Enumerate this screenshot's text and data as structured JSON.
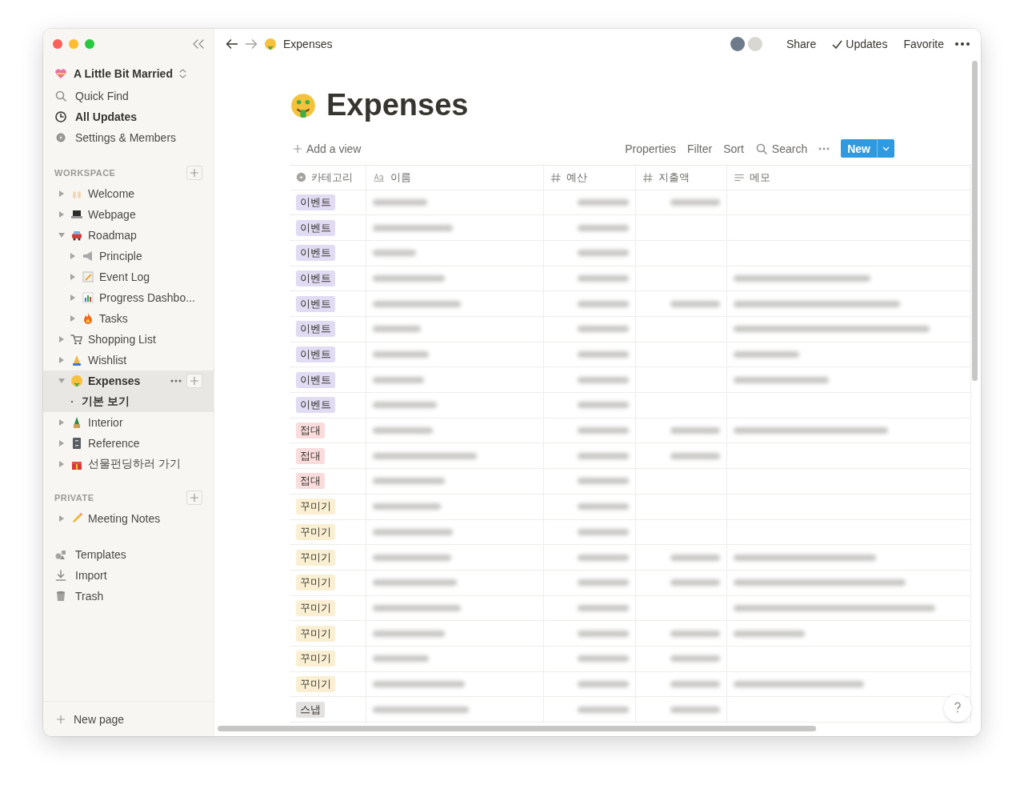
{
  "sidebar": {
    "workspace": "A Little Bit Married",
    "nav": [
      {
        "kind": "search",
        "label": "Quick Find",
        "selected": false
      },
      {
        "kind": "clock",
        "label": "All Updates",
        "selected": true
      },
      {
        "kind": "gear",
        "label": "Settings & Members",
        "selected": false
      }
    ],
    "sections": [
      {
        "title": "WORKSPACE",
        "pages": [
          {
            "label": "Welcome",
            "expanded": false,
            "selected": false
          },
          {
            "label": "Webpage",
            "expanded": false,
            "selected": false
          },
          {
            "label": "Roadmap",
            "expanded": true,
            "selected": false,
            "children": [
              {
                "label": "Principle",
                "expanded": false,
                "selected": false
              },
              {
                "label": "Event Log",
                "expanded": false,
                "selected": false
              },
              {
                "label": "Progress Dashbo...",
                "expanded": false,
                "selected": false
              },
              {
                "label": "Tasks",
                "expanded": false,
                "selected": false
              }
            ]
          },
          {
            "label": "Shopping List",
            "expanded": false,
            "selected": false
          },
          {
            "label": "Wishlist",
            "expanded": false,
            "selected": false
          },
          {
            "label": "Expenses",
            "expanded": true,
            "selected": true,
            "views": [
              {
                "label": "기본 보기",
                "selected": true
              }
            ]
          },
          {
            "label": "Interior",
            "expanded": false,
            "selected": false
          },
          {
            "label": "Reference",
            "expanded": false,
            "selected": false
          },
          {
            "label": "선물펀딩하러 가기",
            "expanded": false,
            "selected": false
          }
        ]
      },
      {
        "title": "PRIVATE",
        "pages": [
          {
            "label": "Meeting Notes",
            "expanded": false,
            "selected": false
          }
        ]
      }
    ],
    "tools": [
      {
        "kind": "templates",
        "label": "Templates"
      },
      {
        "kind": "import",
        "label": "Import"
      },
      {
        "kind": "trash",
        "label": "Trash"
      }
    ],
    "new_page": "New page"
  },
  "topbar": {
    "breadcrumb": "Expenses",
    "actions": [
      {
        "kind": "text",
        "label": "Share"
      },
      {
        "kind": "check",
        "label": "Updates"
      },
      {
        "kind": "text",
        "label": "Favorite"
      }
    ]
  },
  "page": {
    "title": "Expenses",
    "toolbar": {
      "add_view": "Add a view",
      "options": [
        "Properties",
        "Filter",
        "Sort"
      ],
      "search": "Search",
      "new": "New"
    },
    "table": {
      "columns": [
        {
          "kind": "select",
          "label": "카테고리"
        },
        {
          "kind": "title",
          "label": "이름"
        },
        {
          "kind": "number",
          "label": "예산"
        },
        {
          "kind": "number",
          "label": "지출액"
        },
        {
          "kind": "text",
          "label": "메모"
        }
      ],
      "rows": [
        {
          "category": "이벤트",
          "color": "#e2dbf4",
          "spent": true,
          "memo": false
        },
        {
          "category": "이벤트",
          "color": "#e2dbf4",
          "spent": false,
          "memo": false
        },
        {
          "category": "이벤트",
          "color": "#e2dbf4",
          "spent": false,
          "memo": false
        },
        {
          "category": "이벤트",
          "color": "#e2dbf4",
          "spent": false,
          "memo": true
        },
        {
          "category": "이벤트",
          "color": "#e2dbf4",
          "spent": true,
          "memo": true
        },
        {
          "category": "이벤트",
          "color": "#e2dbf4",
          "spent": false,
          "memo": true
        },
        {
          "category": "이벤트",
          "color": "#e2dbf4",
          "spent": false,
          "memo": true
        },
        {
          "category": "이벤트",
          "color": "#e2dbf4",
          "spent": false,
          "memo": true
        },
        {
          "category": "이벤트",
          "color": "#e2dbf4",
          "spent": false,
          "memo": false
        },
        {
          "category": "접대",
          "color": "#fbdcdd",
          "spent": true,
          "memo": true
        },
        {
          "category": "접대",
          "color": "#fbdcdd",
          "spent": true,
          "memo": false
        },
        {
          "category": "접대",
          "color": "#fbdcdd",
          "spent": false,
          "memo": false
        },
        {
          "category": "꾸미기",
          "color": "#fbefd3",
          "spent": false,
          "memo": false
        },
        {
          "category": "꾸미기",
          "color": "#fbefd3",
          "spent": false,
          "memo": false
        },
        {
          "category": "꾸미기",
          "color": "#fbefd3",
          "spent": true,
          "memo": true
        },
        {
          "category": "꾸미기",
          "color": "#fbefd3",
          "spent": true,
          "memo": true
        },
        {
          "category": "꾸미기",
          "color": "#fbefd3",
          "spent": false,
          "memo": true
        },
        {
          "category": "꾸미기",
          "color": "#fbefd3",
          "spent": true,
          "memo": true
        },
        {
          "category": "꾸미기",
          "color": "#fbefd3",
          "spent": true,
          "memo": false
        },
        {
          "category": "꾸미기",
          "color": "#fbefd3",
          "spent": true,
          "memo": true
        },
        {
          "category": "스냅",
          "color": "#e3e2e0",
          "spent": true,
          "memo": false
        }
      ]
    }
  }
}
